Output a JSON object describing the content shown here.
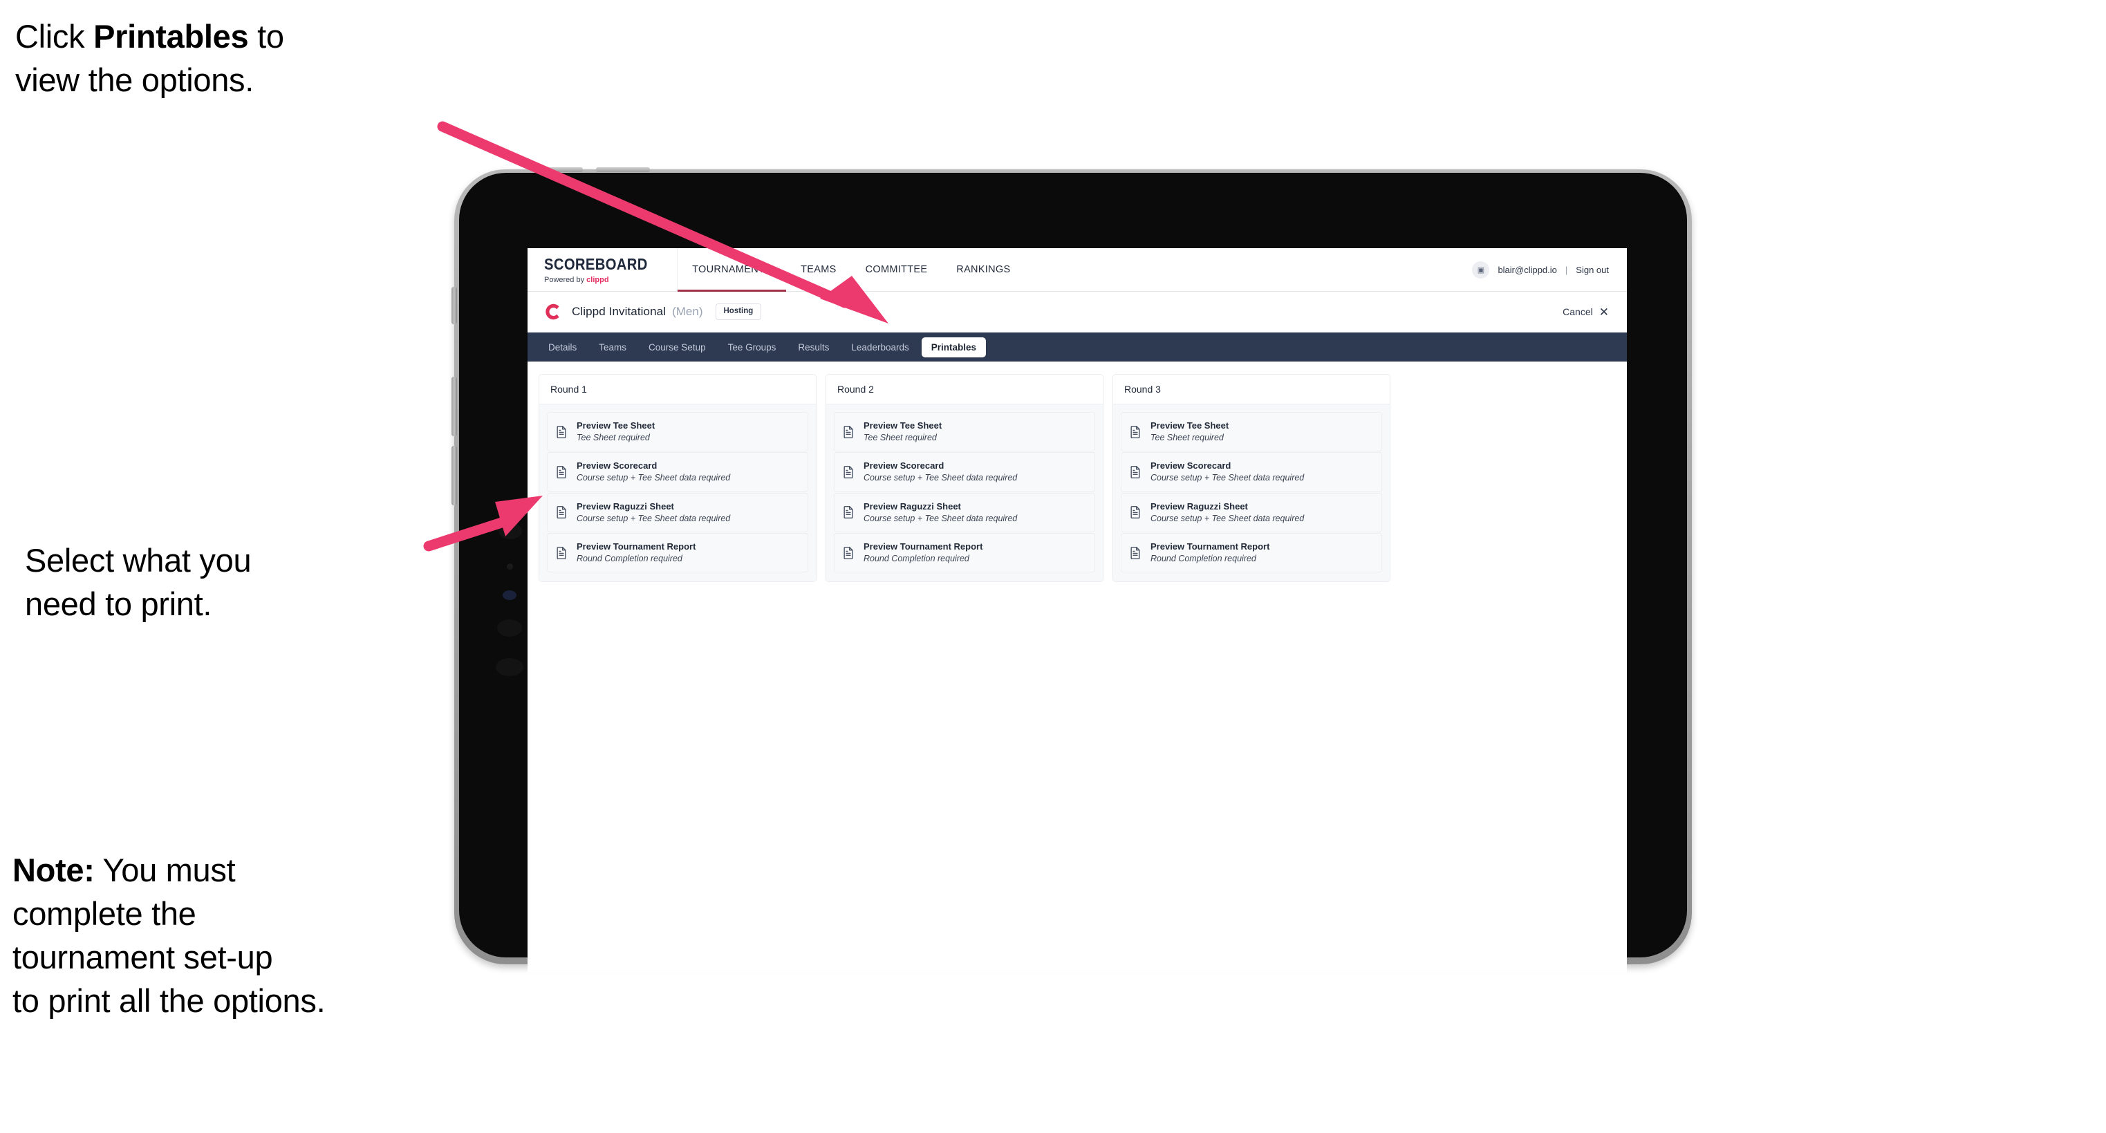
{
  "annotations": {
    "click_printables": "Click <b>Printables</b> to\nview the options.",
    "select_print": "Select what you\n need to print.",
    "note": "<b>Note:</b> You must\ncomplete the\ntournament set-up\nto print all the options."
  },
  "app": {
    "brand": {
      "wordmark": "SCOREBOARD",
      "powered_prefix": "Powered by ",
      "powered_brand": "clippd"
    },
    "top_nav": [
      {
        "label": "TOURNAMENTS",
        "active": true
      },
      {
        "label": "TEAMS",
        "active": false
      },
      {
        "label": "COMMITTEE",
        "active": false
      },
      {
        "label": "RANKINGS",
        "active": false
      }
    ],
    "account": {
      "avatar_glyph": "▣",
      "email": "blair@clippd.io",
      "separator": "|",
      "sign_out": "Sign out"
    },
    "tournament": {
      "logo_letter": "C",
      "name": "Clippd Invitational",
      "gender": "(Men)",
      "status_chip": "Hosting",
      "cancel_label": "Cancel",
      "cancel_icon": "✕"
    },
    "sub_nav": [
      {
        "label": "Details",
        "active": false
      },
      {
        "label": "Teams",
        "active": false
      },
      {
        "label": "Course Setup",
        "active": false
      },
      {
        "label": "Tee Groups",
        "active": false
      },
      {
        "label": "Results",
        "active": false
      },
      {
        "label": "Leaderboards",
        "active": false
      },
      {
        "label": "Printables",
        "active": true
      }
    ],
    "rounds": [
      {
        "title": "Round 1",
        "items": [
          {
            "title": "Preview Tee Sheet",
            "subtitle": "Tee Sheet required"
          },
          {
            "title": "Preview Scorecard",
            "subtitle": "Course setup + Tee Sheet data required"
          },
          {
            "title": "Preview Raguzzi Sheet",
            "subtitle": "Course setup + Tee Sheet data required"
          },
          {
            "title": "Preview Tournament Report",
            "subtitle": "Round Completion required"
          }
        ]
      },
      {
        "title": "Round 2",
        "items": [
          {
            "title": "Preview Tee Sheet",
            "subtitle": "Tee Sheet required"
          },
          {
            "title": "Preview Scorecard",
            "subtitle": "Course setup + Tee Sheet data required"
          },
          {
            "title": "Preview Raguzzi Sheet",
            "subtitle": "Course setup + Tee Sheet data required"
          },
          {
            "title": "Preview Tournament Report",
            "subtitle": "Round Completion required"
          }
        ]
      },
      {
        "title": "Round 3",
        "items": [
          {
            "title": "Preview Tee Sheet",
            "subtitle": "Tee Sheet required"
          },
          {
            "title": "Preview Scorecard",
            "subtitle": "Course setup + Tee Sheet data required"
          },
          {
            "title": "Preview Raguzzi Sheet",
            "subtitle": "Course setup + Tee Sheet data required"
          },
          {
            "title": "Preview Tournament Report",
            "subtitle": "Round Completion required"
          }
        ]
      }
    ]
  },
  "colors": {
    "accent_pink": "#ec3a6e",
    "clippd_red": "#e0305a",
    "subnav_navy": "#2d3a52",
    "tab_underline": "#a33049",
    "card_bg": "#f8f9fa"
  }
}
